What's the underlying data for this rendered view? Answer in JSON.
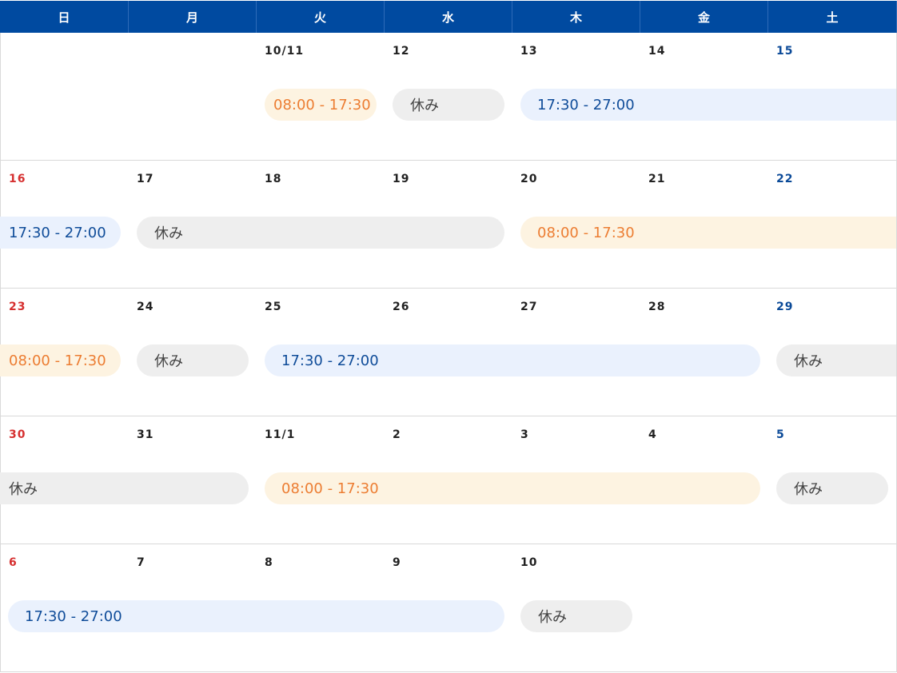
{
  "weekdays": [
    "日",
    "月",
    "火",
    "水",
    "木",
    "金",
    "土"
  ],
  "colors": {
    "header_bg": "#004aa0",
    "sunday": "#d63030",
    "saturday": "#0b4a98",
    "early_shift_bg": "#fdf3e1",
    "early_shift_text": "#ec7d32",
    "late_shift_bg": "#eaf1fd",
    "late_shift_text": "#0f4c99",
    "off_bg": "#eeeeee",
    "off_text": "#444444"
  },
  "weeks": [
    [
      "",
      "",
      "10/11",
      "12",
      "13",
      "14",
      "15"
    ],
    [
      "16",
      "17",
      "18",
      "19",
      "20",
      "21",
      "22"
    ],
    [
      "23",
      "24",
      "25",
      "26",
      "27",
      "28",
      "29"
    ],
    [
      "30",
      "31",
      "11/1",
      "2",
      "3",
      "4",
      "5"
    ],
    [
      "6",
      "7",
      "8",
      "9",
      "10",
      "",
      ""
    ]
  ],
  "events": [
    {
      "week": 0,
      "start": 2,
      "span": 1,
      "type": "shift-early",
      "label": "08:00 - 17:30",
      "cont_left": false,
      "cont_right": false
    },
    {
      "week": 0,
      "start": 3,
      "span": 1,
      "type": "off",
      "label": "休み",
      "cont_left": false,
      "cont_right": false
    },
    {
      "week": 0,
      "start": 4,
      "span": 3,
      "type": "shift-late",
      "label": "17:30 - 27:00",
      "cont_left": false,
      "cont_right": true
    },
    {
      "week": 1,
      "start": 0,
      "span": 1,
      "type": "shift-late",
      "label": "17:30 - 27:00",
      "cont_left": true,
      "cont_right": false
    },
    {
      "week": 1,
      "start": 1,
      "span": 3,
      "type": "off",
      "label": "休み",
      "cont_left": false,
      "cont_right": false
    },
    {
      "week": 1,
      "start": 4,
      "span": 3,
      "type": "shift-early",
      "label": "08:00 - 17:30",
      "cont_left": false,
      "cont_right": true
    },
    {
      "week": 2,
      "start": 0,
      "span": 1,
      "type": "shift-early",
      "label": "08:00 - 17:30",
      "cont_left": true,
      "cont_right": false
    },
    {
      "week": 2,
      "start": 1,
      "span": 1,
      "type": "off",
      "label": "休み",
      "cont_left": false,
      "cont_right": false
    },
    {
      "week": 2,
      "start": 2,
      "span": 4,
      "type": "shift-late",
      "label": "17:30 - 27:00",
      "cont_left": false,
      "cont_right": false
    },
    {
      "week": 2,
      "start": 6,
      "span": 1,
      "type": "off",
      "label": "休み",
      "cont_left": false,
      "cont_right": true
    },
    {
      "week": 3,
      "start": 0,
      "span": 2,
      "type": "off",
      "label": "休み",
      "cont_left": true,
      "cont_right": false
    },
    {
      "week": 3,
      "start": 2,
      "span": 4,
      "type": "shift-early",
      "label": "08:00 - 17:30",
      "cont_left": false,
      "cont_right": false
    },
    {
      "week": 3,
      "start": 6,
      "span": 1,
      "type": "off",
      "label": "休み",
      "cont_left": false,
      "cont_right": false
    },
    {
      "week": 4,
      "start": 0,
      "span": 4,
      "type": "shift-late",
      "label": "17:30 - 27:00",
      "cont_left": false,
      "cont_right": false
    },
    {
      "week": 4,
      "start": 4,
      "span": 1,
      "type": "off",
      "label": "休み",
      "cont_left": false,
      "cont_right": false
    }
  ]
}
